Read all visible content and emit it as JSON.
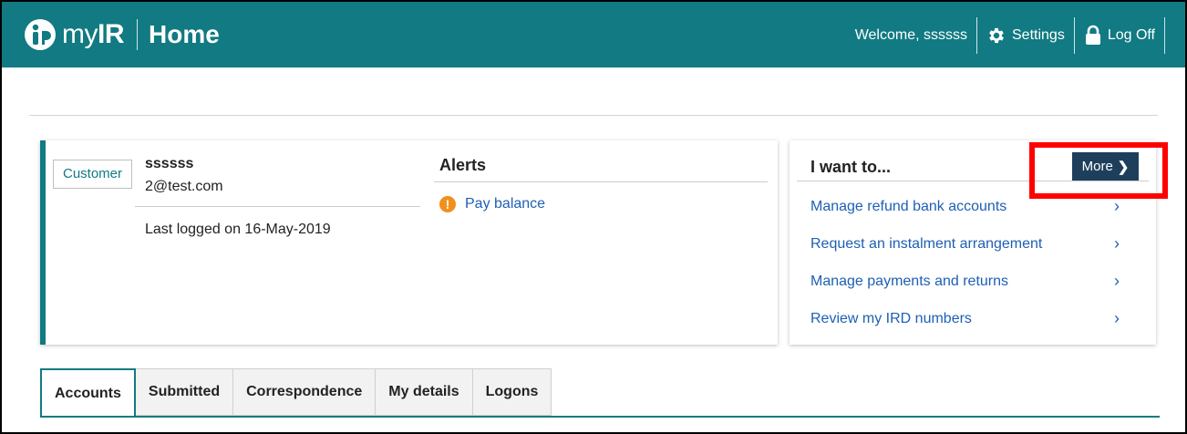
{
  "header": {
    "brand_prefix": "my",
    "brand_suffix": "IR",
    "page_title": "Home",
    "welcome": "Welcome, ssssss",
    "settings_label": "Settings",
    "logoff_label": "Log Off",
    "color": "#117a82"
  },
  "customer": {
    "badge": "Customer",
    "name": "ssssss",
    "email": "2@test.com",
    "last_logged": "Last logged on 16-May-2019"
  },
  "alerts": {
    "title": "Alerts",
    "items": [
      {
        "icon": "exclamation-icon",
        "label": "Pay balance"
      }
    ]
  },
  "want": {
    "title": "I want to...",
    "more_label": "More",
    "items": [
      {
        "label": "Manage refund bank accounts"
      },
      {
        "label": "Request an instalment arrangement"
      },
      {
        "label": "Manage payments and returns"
      },
      {
        "label": "Review my IRD numbers"
      }
    ]
  },
  "tabs": [
    {
      "label": "Accounts",
      "active": true
    },
    {
      "label": "Submitted",
      "active": false
    },
    {
      "label": "Correspondence",
      "active": false
    },
    {
      "label": "My details",
      "active": false
    },
    {
      "label": "Logons",
      "active": false
    }
  ],
  "colors": {
    "accent": "#117a82",
    "link": "#1e5fb4",
    "alert": "#f0901e",
    "highlight": "#ff0000",
    "button": "#1e3f5c"
  }
}
